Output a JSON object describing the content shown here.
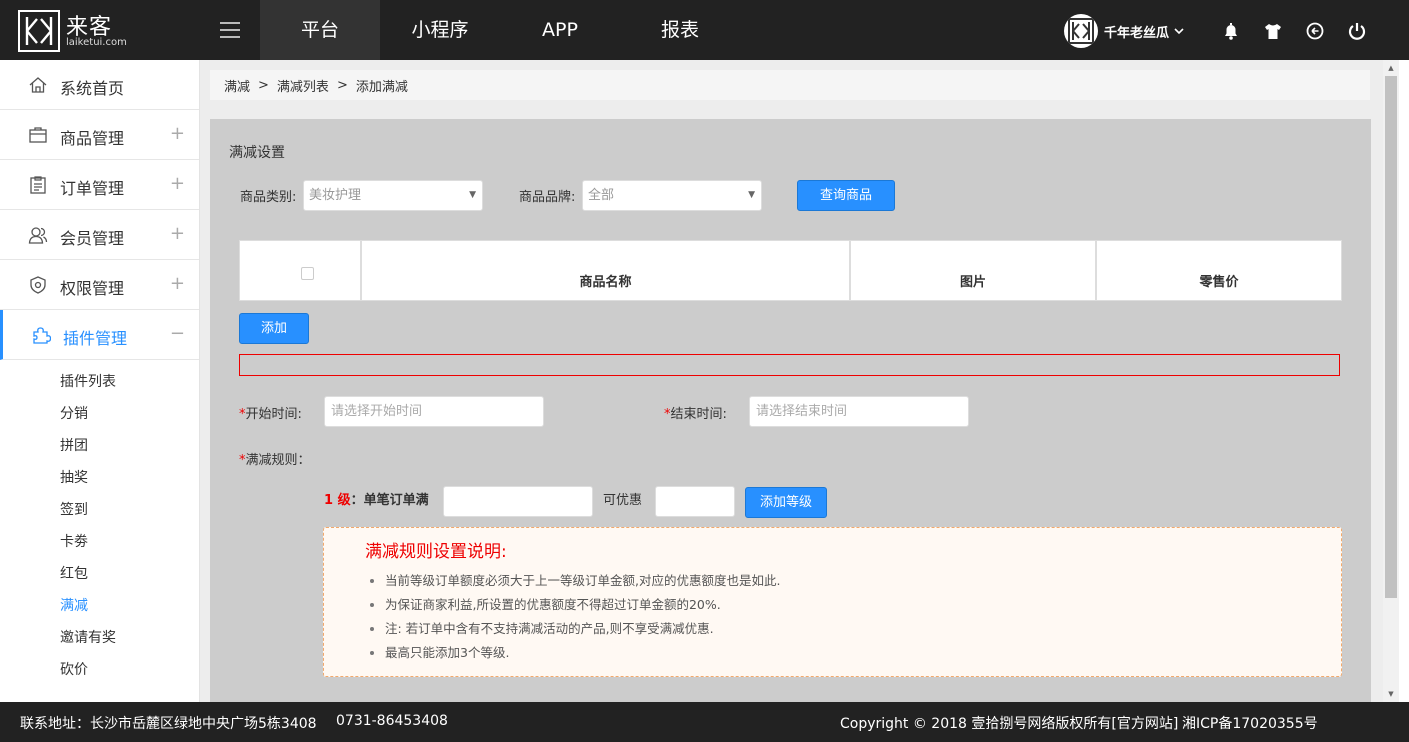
{
  "header": {
    "logo_name": "来客",
    "logo_url": "laiketui.com",
    "nav": [
      "平台",
      "小程序",
      "APP",
      "报表"
    ],
    "user_name": "千年老丝瓜"
  },
  "sidebar": {
    "items": [
      {
        "label": "系统首页",
        "icon": "home-icon",
        "toggle": ""
      },
      {
        "label": "商品管理",
        "icon": "briefcase-icon",
        "toggle": "+"
      },
      {
        "label": "订单管理",
        "icon": "clipboard-icon",
        "toggle": "+"
      },
      {
        "label": "会员管理",
        "icon": "users-icon",
        "toggle": "+"
      },
      {
        "label": "权限管理",
        "icon": "shield-icon",
        "toggle": "+"
      },
      {
        "label": "插件管理",
        "icon": "puzzle-icon",
        "toggle": "−"
      }
    ],
    "subitems": [
      "插件列表",
      "分销",
      "拼团",
      "抽奖",
      "签到",
      "卡劵",
      "红包",
      "满减",
      "邀请有奖",
      "砍价"
    ]
  },
  "breadcrumb": [
    "满减",
    "满减列表",
    "添加满减"
  ],
  "form": {
    "section_title": "满减设置",
    "category_label": "商品类别:",
    "category_value": "美妆护理",
    "brand_label": "商品品牌:",
    "brand_value": "全部",
    "query_button": "查询商品",
    "table_headers": [
      "商品名称",
      "图片",
      "零售价"
    ],
    "add_button": "添加",
    "start_label": "开始时间:",
    "start_placeholder": "请选择开始时间",
    "end_label": "结束时间:",
    "end_placeholder": "请选择结束时间",
    "rule_label": "满减规则：",
    "required_mark": "*",
    "level_num": "1 级",
    "level_text": "：单笔订单满",
    "discount_label": "可优惠",
    "add_level_button": "添加等级"
  },
  "note": {
    "title": "满减规则设置说明:",
    "items": [
      "当前等级订单额度必须大于上一等级订单金额,对应的优惠额度也是如此.",
      "为保证商家利益,所设置的优惠额度不得超过订单金额的20%.",
      "注: 若订单中含有不支持满减活动的产品,则不享受满减优惠.",
      "最高只能添加3个等级."
    ]
  },
  "footer": {
    "address": "联系地址：长沙市岳麓区绿地中央广场5栋3408",
    "phone": "0731-86453408",
    "copyright": "Copyright © 2018 壹拾捌号网络版权所有[官方网站]",
    "icp": "湘ICP备17020355号"
  }
}
